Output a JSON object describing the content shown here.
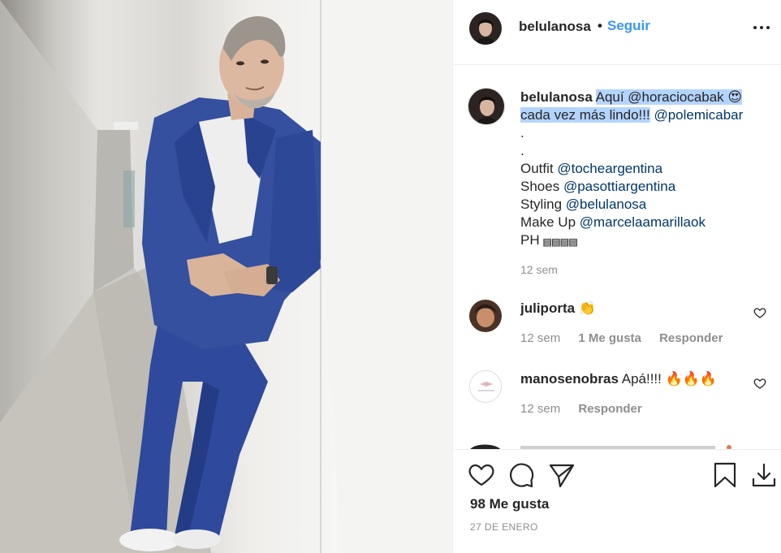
{
  "post": {
    "photo_alt": "",
    "author": {
      "username": "belulanosa",
      "separator": "•",
      "follow_label": "Seguir",
      "more_icon": "more-options-icon"
    },
    "caption": {
      "username": "belulanosa",
      "line1_hl": "Aquí @horaciocabak 😍",
      "line2_hl": "cada vez más lindo!!!",
      "line2_rest": "@polemicabar",
      "dot1": ".",
      "dot2": ".",
      "outfit_label": "Outfit",
      "outfit_mention": "@tocheargentina",
      "shoes_label": "Shoes",
      "shoes_mention": "@pasottiargentina",
      "styling_label": "Styling",
      "styling_mention": "@belulanosa",
      "makeup_label": "Make Up",
      "makeup_mention": "@marcelaamarillaok",
      "ph_label": "PH",
      "ph_icons": "▤▤▤▤",
      "time": "12 sem"
    },
    "comments": [
      {
        "username": "juliporta",
        "text": "👏",
        "time": "12 sem",
        "likes": "1 Me gusta",
        "reply": "Responder"
      },
      {
        "username": "manosenobras",
        "text": "Apá!!!! 🔥🔥🔥",
        "time": "12 sem",
        "reply": "Responder"
      }
    ],
    "footer": {
      "likes": "98 Me gusta",
      "date": "27 DE ENERO",
      "icons": [
        "heart-icon",
        "comment-icon",
        "share-icon",
        "save-icon",
        "download-icon"
      ]
    },
    "colors": {
      "link": "#3897f0",
      "mention": "#00376b",
      "muted": "#8e8e8e",
      "text": "#262626",
      "highlight": "#b3d4fc"
    }
  }
}
